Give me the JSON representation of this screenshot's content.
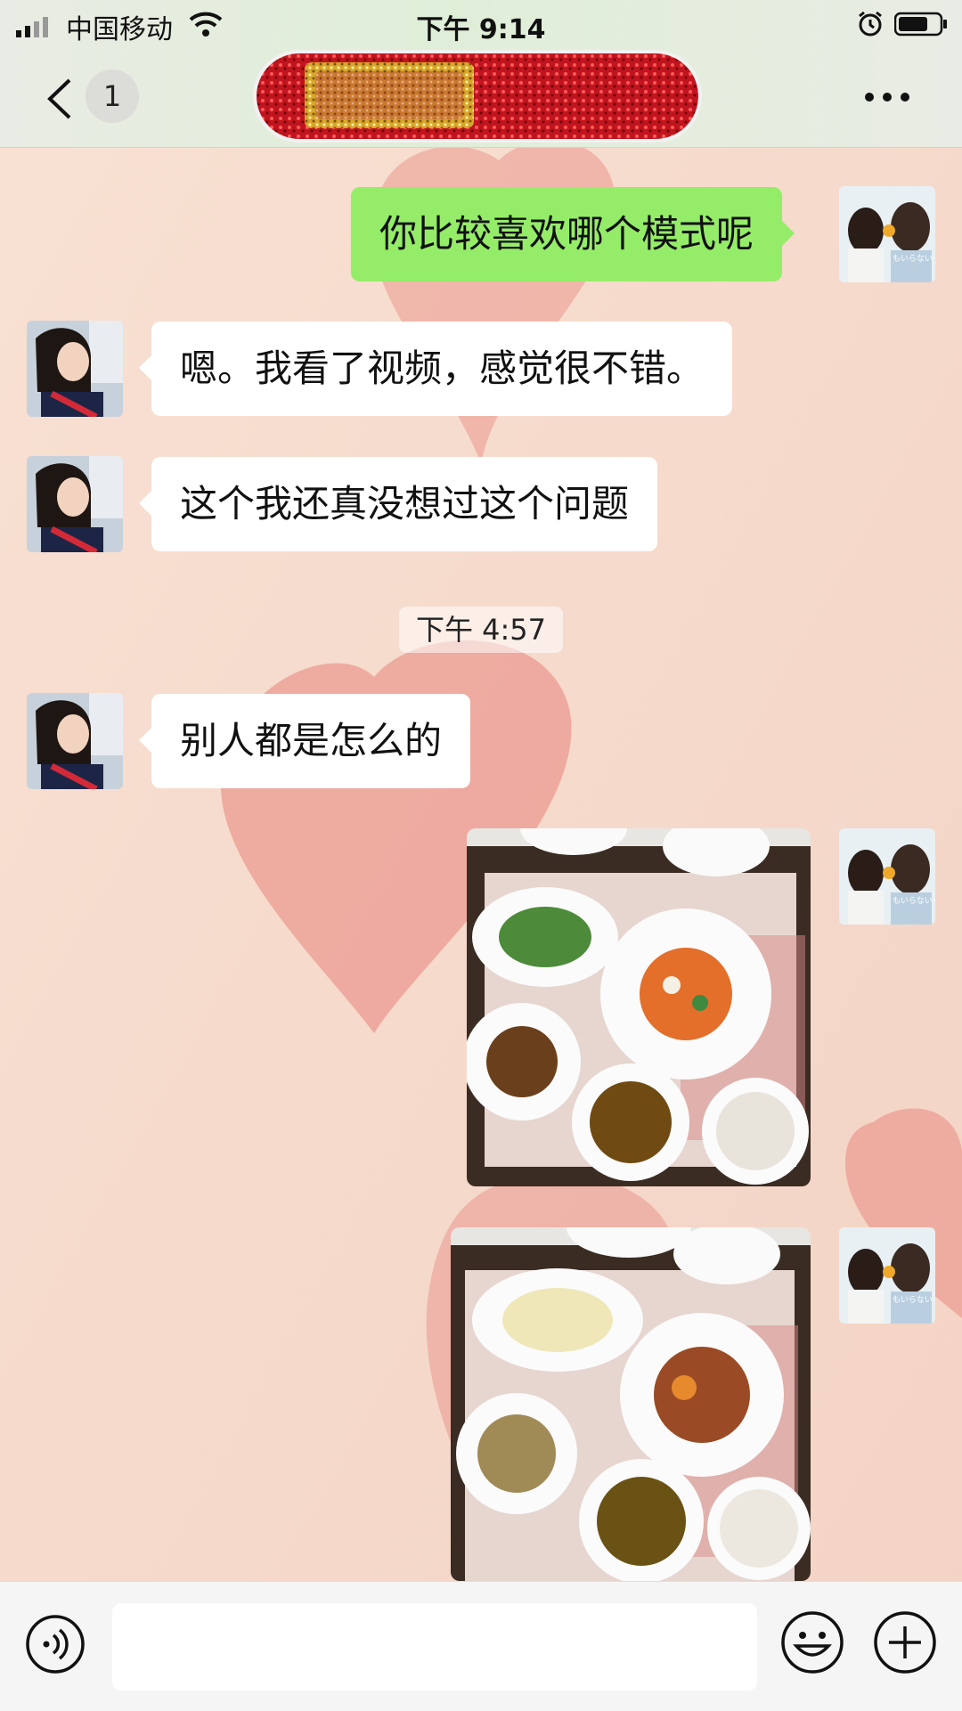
{
  "status_bar": {
    "carrier": "中国移动",
    "time": "下午 9:14"
  },
  "header": {
    "unread_count": "1",
    "title_sticker_icon": "glitter-sticker-title"
  },
  "messages": [
    {
      "side": "out",
      "type": "text",
      "text": "你比较喜欢哪个模式呢",
      "avatar": "mother-daughter-photo-avatar"
    },
    {
      "side": "in",
      "type": "text",
      "text": "嗯。我看了视频，感觉很不错。",
      "avatar": "girl-photo-avatar"
    },
    {
      "side": "in",
      "type": "text",
      "text": "这个我还真没想过这个问题",
      "avatar": "girl-photo-avatar"
    },
    {
      "type": "timestamp",
      "text": "下午 4:57"
    },
    {
      "side": "in",
      "type": "text",
      "text": "别人都是怎么的",
      "avatar": "girl-photo-avatar"
    },
    {
      "side": "out",
      "type": "image",
      "image": "meal-tray-photo-1",
      "avatar": "mother-daughter-photo-avatar"
    },
    {
      "side": "out",
      "type": "image",
      "image": "meal-tray-photo-2",
      "avatar": "mother-daughter-photo-avatar"
    }
  ],
  "input_bar": {
    "placeholder": ""
  },
  "colors": {
    "outgoing_bubble": "#95ec69",
    "incoming_bubble": "#ffffff",
    "wallpaper": "#f6dccb",
    "heart": "#e98a82"
  }
}
